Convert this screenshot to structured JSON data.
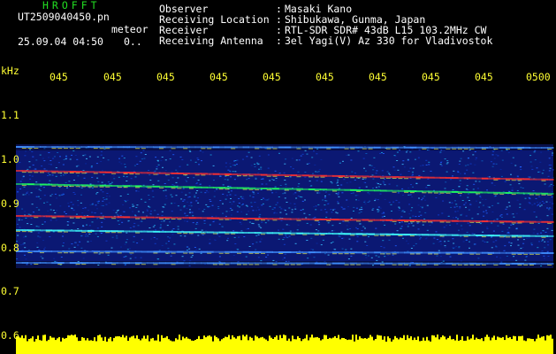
{
  "header": {
    "app_title": "HROFFT",
    "file_name": "UT2509040450.pn",
    "meteor_label": "meteor",
    "date_time": "25.09.04 04:50",
    "count_value": "0.."
  },
  "meta": [
    {
      "key": "Observer",
      "sep": ":",
      "value": "Masaki Kano"
    },
    {
      "key": "Receiving Location",
      "sep": ":",
      "value": "Shibukawa, Gunma, Japan"
    },
    {
      "key": "Receiver",
      "sep": ":",
      "value": "RTL-SDR SDR# 43dB L15 103.2MHz CW"
    },
    {
      "key": "Receiving Antenna",
      "sep": ":",
      "value": "3el Yagi(V) Az 330 for Vladivostok"
    }
  ],
  "axis": {
    "unit": "kHz",
    "freq_ticks": [
      "1.1",
      "1.0",
      "0.9",
      "0.8",
      "0.7",
      "0.6"
    ],
    "time_ticks": [
      "045",
      "045",
      "045",
      "045",
      "045",
      "045",
      "045",
      "045",
      "045",
      "0500"
    ]
  },
  "colors": {
    "background": "#000000",
    "title": "#22dd22",
    "text": "#ffffff",
    "axis_label": "#ffff33",
    "noise_floor": "#ffff00"
  }
}
